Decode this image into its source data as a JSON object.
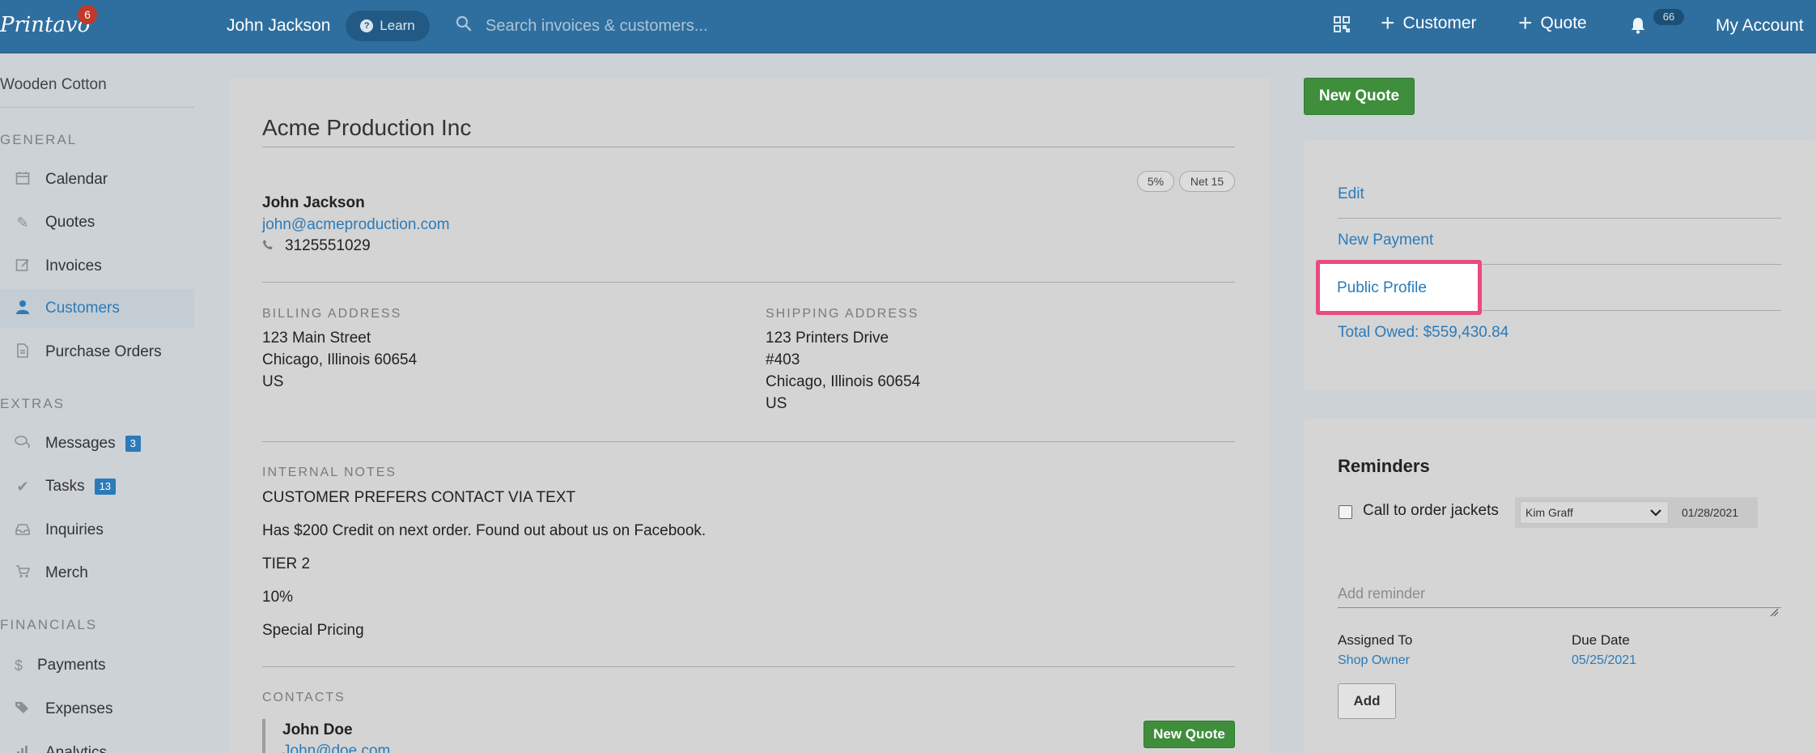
{
  "topbar": {
    "logo": "Printavo",
    "logo_badge": "6",
    "user_name": "John Jackson",
    "learn_label": "Learn",
    "search_placeholder": "Search invoices & customers...",
    "customer_label": "Customer",
    "quote_label": "Quote",
    "notifications_count": "66",
    "account_label": "My Account",
    "icons": [
      "qr-code-icon",
      "plus-icon",
      "bell-icon",
      "search-icon",
      "question-icon"
    ]
  },
  "sidebar": {
    "company": "Wooden Cotton",
    "sections": [
      {
        "title": "GENERAL",
        "items": [
          {
            "label": "Calendar",
            "icon": "calendar-icon"
          },
          {
            "label": "Quotes",
            "icon": "pencil-icon"
          },
          {
            "label": "Invoices",
            "icon": "edit-icon"
          },
          {
            "label": "Customers",
            "icon": "user-icon",
            "active": true
          },
          {
            "label": "Purchase Orders",
            "icon": "file-icon"
          }
        ]
      },
      {
        "title": "EXTRAS",
        "items": [
          {
            "label": "Messages",
            "icon": "chat-icon",
            "count": "3"
          },
          {
            "label": "Tasks",
            "icon": "check-icon",
            "count": "13"
          },
          {
            "label": "Inquiries",
            "icon": "inbox-icon"
          },
          {
            "label": "Merch",
            "icon": "cart-icon"
          }
        ]
      },
      {
        "title": "FINANCIALS",
        "items": [
          {
            "label": "Payments",
            "icon": "dollar-icon"
          },
          {
            "label": "Expenses",
            "icon": "tags-icon"
          },
          {
            "label": "Analytics",
            "icon": "bar-chart-icon"
          }
        ]
      }
    ]
  },
  "customer": {
    "name": "Acme Production Inc",
    "tags": [
      "5%",
      "Net 15"
    ],
    "contact_name": "John Jackson",
    "email": "john@acmeproduction.com",
    "phone": "3125551029",
    "billing": {
      "label": "BILLING ADDRESS",
      "lines": [
        "123 Main Street",
        "Chicago, Illinois 60654",
        "US"
      ]
    },
    "shipping": {
      "label": "SHIPPING ADDRESS",
      "lines": [
        "123 Printers Drive",
        "#403",
        "Chicago, Illinois 60654",
        "US"
      ]
    },
    "notes": {
      "label": "INTERNAL NOTES",
      "lines": [
        "CUSTOMER PREFERS CONTACT VIA TEXT",
        "Has $200 Credit on next order. Found out about us on Facebook.",
        "TIER 2",
        "10%",
        "Special Pricing"
      ]
    },
    "contacts": {
      "label": "CONTACTS",
      "first_name": "John Doe",
      "first_email": "John@doe.com",
      "new_quote_label": "New Quote"
    }
  },
  "right": {
    "new_quote_label": "New Quote",
    "links": {
      "edit": "Edit",
      "new_payment": "New Payment",
      "public_profile": "Public Profile",
      "total_owed": "Total Owed: $559,430.84"
    },
    "reminders": {
      "title": "Reminders",
      "item_text": "Call to order jackets",
      "item_assignee": "Kim Graff",
      "item_date": "01/28/2021",
      "add_placeholder": "Add reminder",
      "assigned_label": "Assigned To",
      "assigned_value": "Shop Owner",
      "due_label": "Due Date",
      "due_value": "05/25/2021",
      "add_label": "Add"
    }
  },
  "colors": {
    "topbar": "#2f6f9f",
    "link": "#2b7bb9",
    "green": "#3e8e3c",
    "highlight": "#e94b7d"
  }
}
